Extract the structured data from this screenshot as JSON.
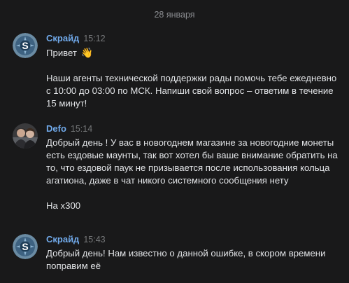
{
  "date_separator": "28 января",
  "messages": [
    {
      "author": "Скрайд",
      "time": "15:12",
      "lines": [
        "Привет",
        "Наши агенты технической поддержки рады помочь тебе ежедневно с 10:00 до 03:00 по МСК. Напиши свой вопрос – ответим в течение 15 минут!"
      ],
      "emoji": "👋"
    },
    {
      "author": "Defo",
      "time": "15:14",
      "lines": [
        "Добрый день ! У вас в новогоднем магазине за новогодние монеты есть ездовые маунты, так вот хотел бы ваше внимание обратить на то, что ездовой паук не призывается после использования кольца агатиона, даже в чат никого системного сообщения нету",
        "На х300"
      ]
    },
    {
      "author": "Скрайд",
      "time": "15:43",
      "lines": [
        "Добрый день! Нам известно о данной ошибке, в скором времени поправим её"
      ]
    }
  ],
  "colors": {
    "background": "#19191a",
    "author": "#71aaeb",
    "time": "#76787a",
    "text": "#e1e3e6"
  },
  "icons": {
    "support_avatar": "skryd-shield-logo",
    "user_avatar": "user-photo"
  }
}
